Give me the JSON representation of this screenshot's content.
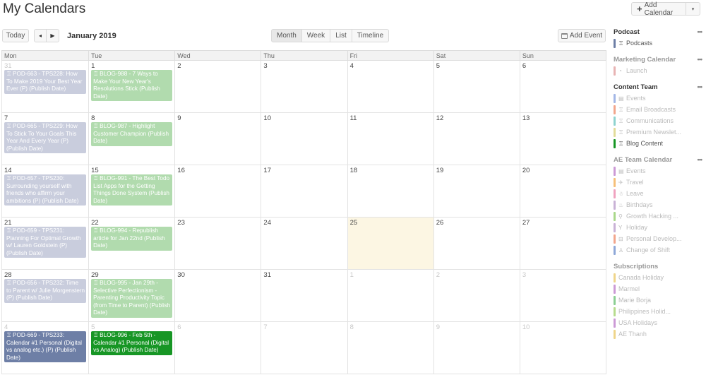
{
  "header": {
    "title": "My Calendars",
    "add_calendar_label": "Add Calendar",
    "add_calendar_dropdown": "▾"
  },
  "toolbar": {
    "today_label": "Today",
    "prev_icon": "◂",
    "next_icon": "▶",
    "month_label": "January 2019",
    "views": [
      "Month",
      "Week",
      "List",
      "Timeline"
    ],
    "active_view": "Month",
    "add_event_label": "Add Event"
  },
  "calendar": {
    "weekdays": [
      "Mon",
      "Tue",
      "Wed",
      "Thu",
      "Fri",
      "Sat",
      "Sun"
    ],
    "today": "25",
    "weeks": [
      {
        "days": [
          "31",
          "1",
          "2",
          "3",
          "4",
          "5",
          "6"
        ],
        "other": [
          true,
          false,
          false,
          false,
          false,
          false,
          false
        ],
        "events": [
          {
            "day": 0,
            "type": "pod",
            "icon": "🏆",
            "text": "POD-663 - TPS228: How To Make 2019 Your Best Year Ever (P) (Publish Date)"
          },
          {
            "day": 1,
            "type": "blog",
            "icon": "🏆",
            "text": "BLOG-988 - 7 Ways to Make Your New Year's Resolutions Stick (Publish Date)"
          }
        ]
      },
      {
        "days": [
          "7",
          "8",
          "9",
          "10",
          "11",
          "12",
          "13"
        ],
        "other": [
          false,
          false,
          false,
          false,
          false,
          false,
          false
        ],
        "events": [
          {
            "day": 0,
            "type": "pod",
            "icon": "🏆",
            "text": "POD-665 - TPS229: How To Stick To Your Goals This Year And Every Year (P) (Publish Date)"
          },
          {
            "day": 1,
            "type": "blog",
            "icon": "🏆",
            "text": "BLOG-987 - Highlight Customer Champion (Publish Date)"
          }
        ]
      },
      {
        "days": [
          "14",
          "15",
          "16",
          "17",
          "18",
          "19",
          "20"
        ],
        "other": [
          false,
          false,
          false,
          false,
          false,
          false,
          false
        ],
        "events": [
          {
            "day": 0,
            "type": "pod",
            "icon": "🏆",
            "text": "POD-657 - TPS230: Surrounding yourself with friends who affirm your ambitions (P) (Publish Date)"
          },
          {
            "day": 1,
            "type": "blog",
            "icon": "🏆",
            "text": "BLOG-991 - The Best Todo List Apps for the Getting Things Done System (Publish Date)"
          }
        ]
      },
      {
        "days": [
          "21",
          "22",
          "23",
          "24",
          "25",
          "26",
          "27"
        ],
        "other": [
          false,
          false,
          false,
          false,
          false,
          false,
          false
        ],
        "events": [
          {
            "day": 0,
            "type": "pod",
            "icon": "🏆",
            "text": "POD-659 - TPS231: Planning For Optimal Growth w/ Lauren Goldstein (P) (Publish Date)"
          },
          {
            "day": 1,
            "type": "blog",
            "icon": "🏆",
            "text": "BLOG-994 - Republish article for Jan 22nd (Publish Date)"
          }
        ]
      },
      {
        "days": [
          "28",
          "29",
          "30",
          "31",
          "1",
          "2",
          "3"
        ],
        "other": [
          false,
          false,
          false,
          false,
          true,
          true,
          true
        ],
        "events": [
          {
            "day": 0,
            "type": "pod",
            "icon": "🏆",
            "text": "POD-656 - TPS232: Time to Parent w/ Julie Morgenstern (P) (Publish Date)"
          },
          {
            "day": 1,
            "type": "blog",
            "icon": "🏆",
            "text": "BLOG-995 - Jan 29th - Selective Perfectionism - Parenting Productivity Topic (from Time to Parent) (Publish Date)"
          }
        ]
      },
      {
        "days": [
          "4",
          "5",
          "6",
          "7",
          "8",
          "9",
          "10"
        ],
        "other": [
          true,
          true,
          true,
          true,
          true,
          true,
          true
        ],
        "events": [
          {
            "day": 0,
            "type": "pod-active",
            "icon": "🏆",
            "text": "POD-669 - TPS233: Calendar #1 Personal (Digital vs analog etc.) (P) (Publish Date)"
          },
          {
            "day": 1,
            "type": "blog-active",
            "icon": "🏆",
            "text": "BLOG-996 - Feb 5th - Calendar #1 Personal (Digital vs Analog) (Publish Date)"
          }
        ]
      }
    ]
  },
  "sidebar": {
    "groups": [
      {
        "title": "Podcast",
        "dim": false,
        "more": "•••",
        "items": [
          {
            "label": "Podcasts",
            "icon": "trophy-icon",
            "glyph": "♖",
            "color": "#6e7fa6",
            "on": true
          }
        ]
      },
      {
        "title": "Marketing Calendar",
        "dim": true,
        "more": "•••",
        "items": [
          {
            "label": "Launch",
            "icon": "rocket-icon",
            "glyph": "◔",
            "color": "#e8b4b4",
            "on": false
          }
        ]
      },
      {
        "title": "Content Team",
        "dim": false,
        "more": "•••",
        "items": [
          {
            "label": "Events",
            "icon": "calendar-icon",
            "glyph": "▤",
            "color": "#a3b7e6",
            "on": false
          },
          {
            "label": "Email Broadcasts",
            "icon": "trophy-icon",
            "glyph": "♖",
            "color": "#f2a68c",
            "on": false
          },
          {
            "label": "Communications",
            "icon": "trophy-icon",
            "glyph": "♖",
            "color": "#8fd3cf",
            "on": false
          },
          {
            "label": "Premium Newslet...",
            "icon": "trophy-icon",
            "glyph": "♖",
            "color": "#e2dc9a",
            "on": false
          },
          {
            "label": "Blog Content",
            "icon": "trophy-icon",
            "glyph": "♖",
            "color": "#179625",
            "on": true
          }
        ]
      },
      {
        "title": "AE Team Calendar",
        "dim": true,
        "more": "•••",
        "items": [
          {
            "label": "Events",
            "icon": "calendar-icon",
            "glyph": "▤",
            "color": "#cc9ad6",
            "on": false
          },
          {
            "label": "Travel",
            "icon": "plane-icon",
            "glyph": "✈",
            "color": "#f6c07a",
            "on": false
          },
          {
            "label": "Leave",
            "icon": "person-icon",
            "glyph": "☃",
            "color": "#f0a3c0",
            "on": false
          },
          {
            "label": "Birthdays",
            "icon": "cake-icon",
            "glyph": "♨",
            "color": "#c9b2d6",
            "on": false
          },
          {
            "label": "Growth Hacking ...",
            "icon": "search-icon",
            "glyph": "⚲",
            "color": "#a9d88a",
            "on": false
          },
          {
            "label": "Holiday",
            "icon": "cocktail-icon",
            "glyph": "Y",
            "color": "#c9b2d6",
            "on": false
          },
          {
            "label": "Personal Develop...",
            "icon": "graduation-icon",
            "glyph": "⊟",
            "color": "#f2a68c",
            "on": false
          },
          {
            "label": "Change of Shift",
            "icon": "bell-icon",
            "glyph": "♙",
            "color": "#8fa8d8",
            "on": false
          }
        ]
      },
      {
        "title": "Subscriptions",
        "dim": true,
        "more": "",
        "items": [
          {
            "label": "Canada Holiday",
            "icon": "",
            "glyph": "",
            "color": "#efd58a",
            "on": false
          },
          {
            "label": "Marmel",
            "icon": "",
            "glyph": "",
            "color": "#cc9ad6",
            "on": false
          },
          {
            "label": "Marie Borja",
            "icon": "",
            "glyph": "",
            "color": "#8ccf94",
            "on": false
          },
          {
            "label": "Philippines Holid...",
            "icon": "",
            "glyph": "",
            "color": "#b7dc8e",
            "on": false
          },
          {
            "label": "USA Holidays",
            "icon": "",
            "glyph": "",
            "color": "#cc9ad6",
            "on": false
          },
          {
            "label": "AE Thanh",
            "icon": "",
            "glyph": "",
            "color": "#efd58a",
            "on": false
          }
        ]
      }
    ]
  }
}
